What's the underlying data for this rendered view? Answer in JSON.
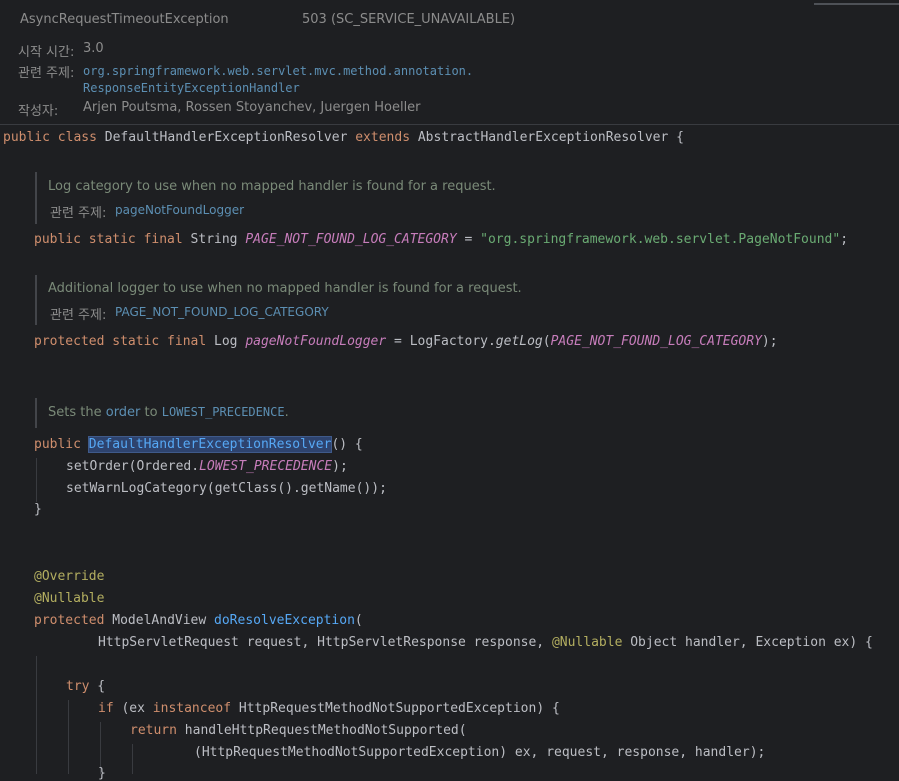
{
  "javadoc_header": {
    "exception_name": "AsyncRequestTimeoutException",
    "exception_status": "503 (SC_SERVICE_UNAVAILABLE)",
    "since_label": "시작 시간:",
    "since_value": "3.0",
    "see_label": "관련 주제:",
    "see_value_line1": "org.springframework.web.servlet.mvc.method.annotation.",
    "see_value_line2": "ResponseEntityExceptionHandler",
    "author_label": "작성자:",
    "authors": "Arjen Poutsma, Rossen Stoyanchev, Juergen Hoeller"
  },
  "class_decl": {
    "mod": "public",
    "kw_class": "class",
    "name": "DefaultHandlerExceptionResolver",
    "kw_extends": "extends",
    "parent": "AbstractHandlerExceptionResolver",
    "brace": "{"
  },
  "doc1": {
    "text": "Log category to use when no mapped handler is found for a request.",
    "see_label": "관련 주제:",
    "see_value": "pageNotFoundLogger"
  },
  "field1": {
    "mods": "public static final",
    "type": "String",
    "name": "PAGE_NOT_FOUND_LOG_CATEGORY",
    "assign": "=",
    "value": "\"org.springframework.web.servlet.PageNotFound\"",
    "semi": ";"
  },
  "doc2": {
    "text": "Additional logger to use when no mapped handler is found for a request.",
    "see_label": "관련 주제:",
    "see_value": "PAGE_NOT_FOUND_LOG_CATEGORY"
  },
  "field2": {
    "mods": "protected static final",
    "type": "Log",
    "name": "pageNotFoundLogger",
    "assign": "= LogFactory.",
    "method": "getLog",
    "arg": "PAGE_NOT_FOUND_LOG_CATEGORY",
    "close": ");"
  },
  "doc3": {
    "prefix": "Sets the ",
    "link": "order",
    "middle": " to ",
    "code": "LOWEST_PRECEDENCE",
    "suffix": "."
  },
  "ctor": {
    "mod": "public",
    "name": "DefaultHandlerExceptionResolver",
    "params": "() {",
    "l1_a": "setOrder(Ordered.",
    "l1_b": "LOWEST_PRECEDENCE",
    "l1_c": ");",
    "l2": "setWarnLogCategory(getClass().getName());",
    "close": "}"
  },
  "method": {
    "ann1": "@Override",
    "ann2": "@Nullable",
    "mod": "protected",
    "ret": "ModelAndView",
    "name": "doResolveException",
    "open": "(",
    "params_a": "HttpServletRequest request, HttpServletResponse response, ",
    "params_ann": "@Nullable",
    "params_b": " Object handler, Exception ex) {",
    "try_kw": "try",
    "try_rest": " {",
    "if_kw": "if",
    "if_a": " (ex ",
    "if_inst": "instanceof",
    "if_b": " HttpRequestMethodNotSupportedException) {",
    "ret_kw": "return",
    "ret_rest": " handleHttpRequestMethodNotSupported(",
    "ret_args": "(HttpRequestMethodNotSupportedException) ex, request, response, handler);",
    "partial": "}"
  }
}
